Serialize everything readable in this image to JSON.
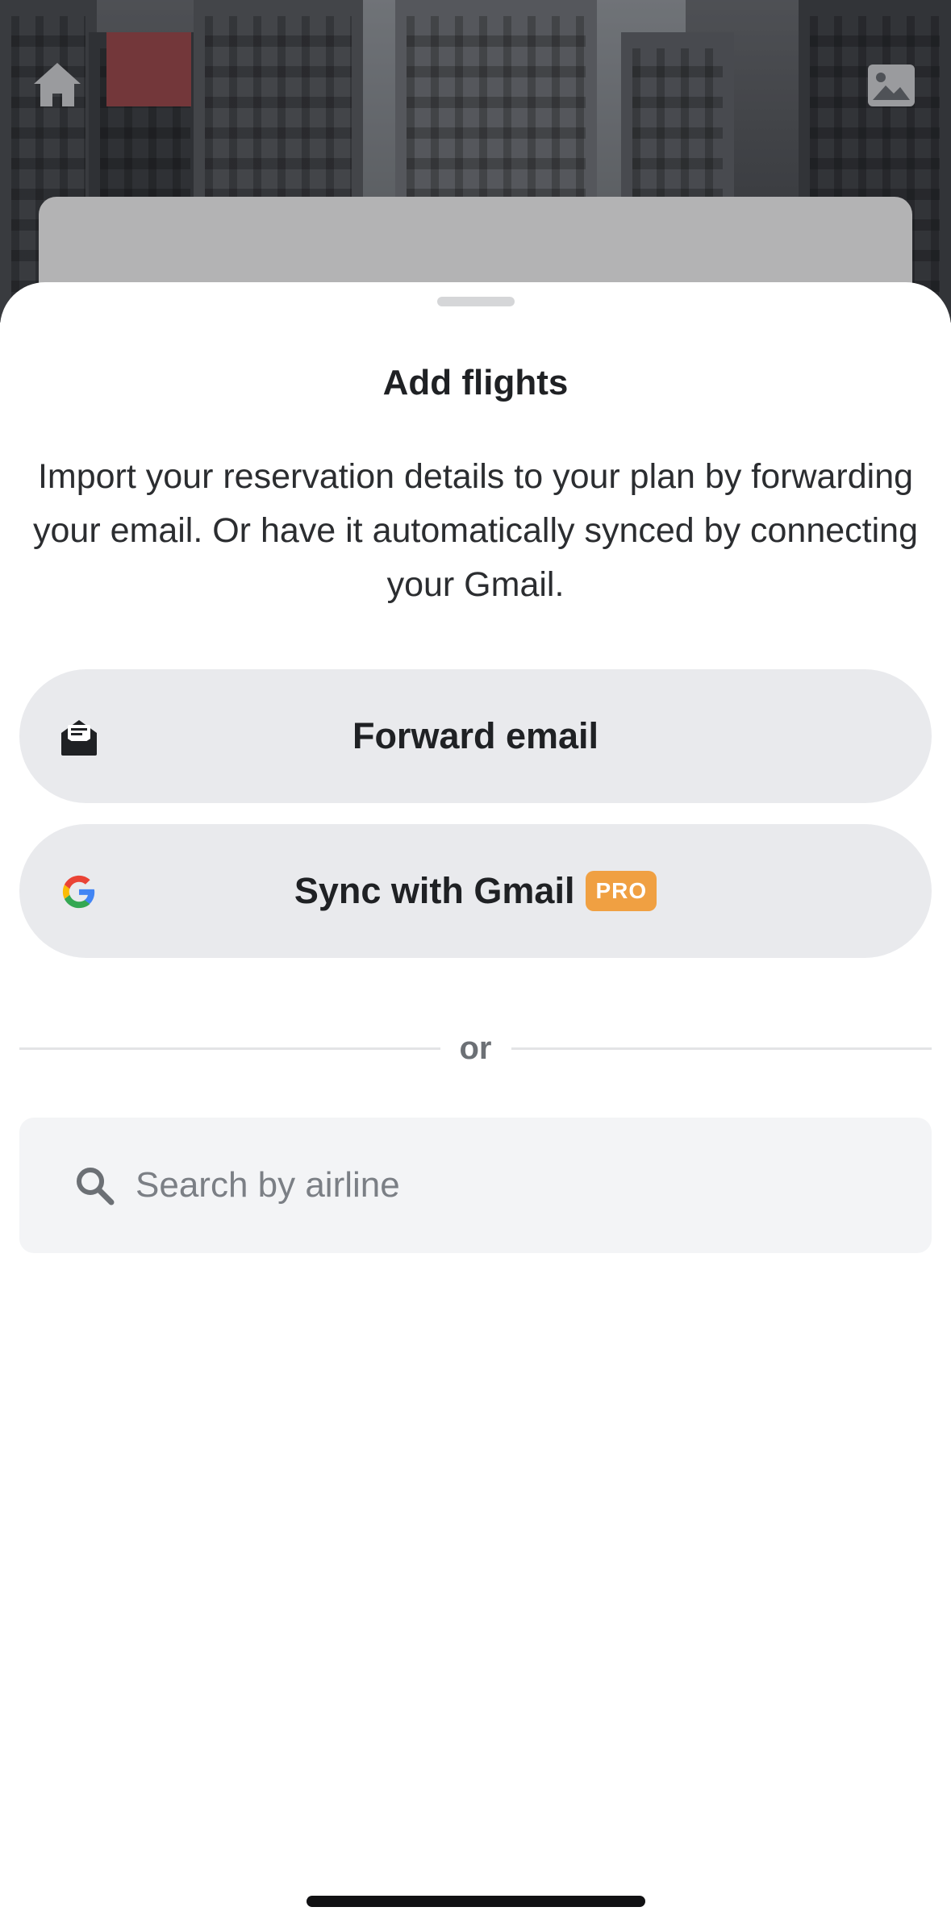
{
  "background": {
    "home_icon": "home-icon",
    "image_icon": "image-icon"
  },
  "sheet": {
    "title": "Add flights",
    "description": "Import your reservation details to your plan by forwarding your email. Or have it automatically synced by connecting your Gmail.",
    "forward_button": {
      "label": "Forward email",
      "icon": "envelope-open-icon"
    },
    "gmail_button": {
      "label": "Sync with Gmail",
      "icon": "google-icon",
      "badge": "PRO",
      "badge_color": "#f0a042"
    },
    "divider_text": "or",
    "search": {
      "placeholder": "Search by airline",
      "value": "",
      "icon": "search-icon"
    }
  }
}
